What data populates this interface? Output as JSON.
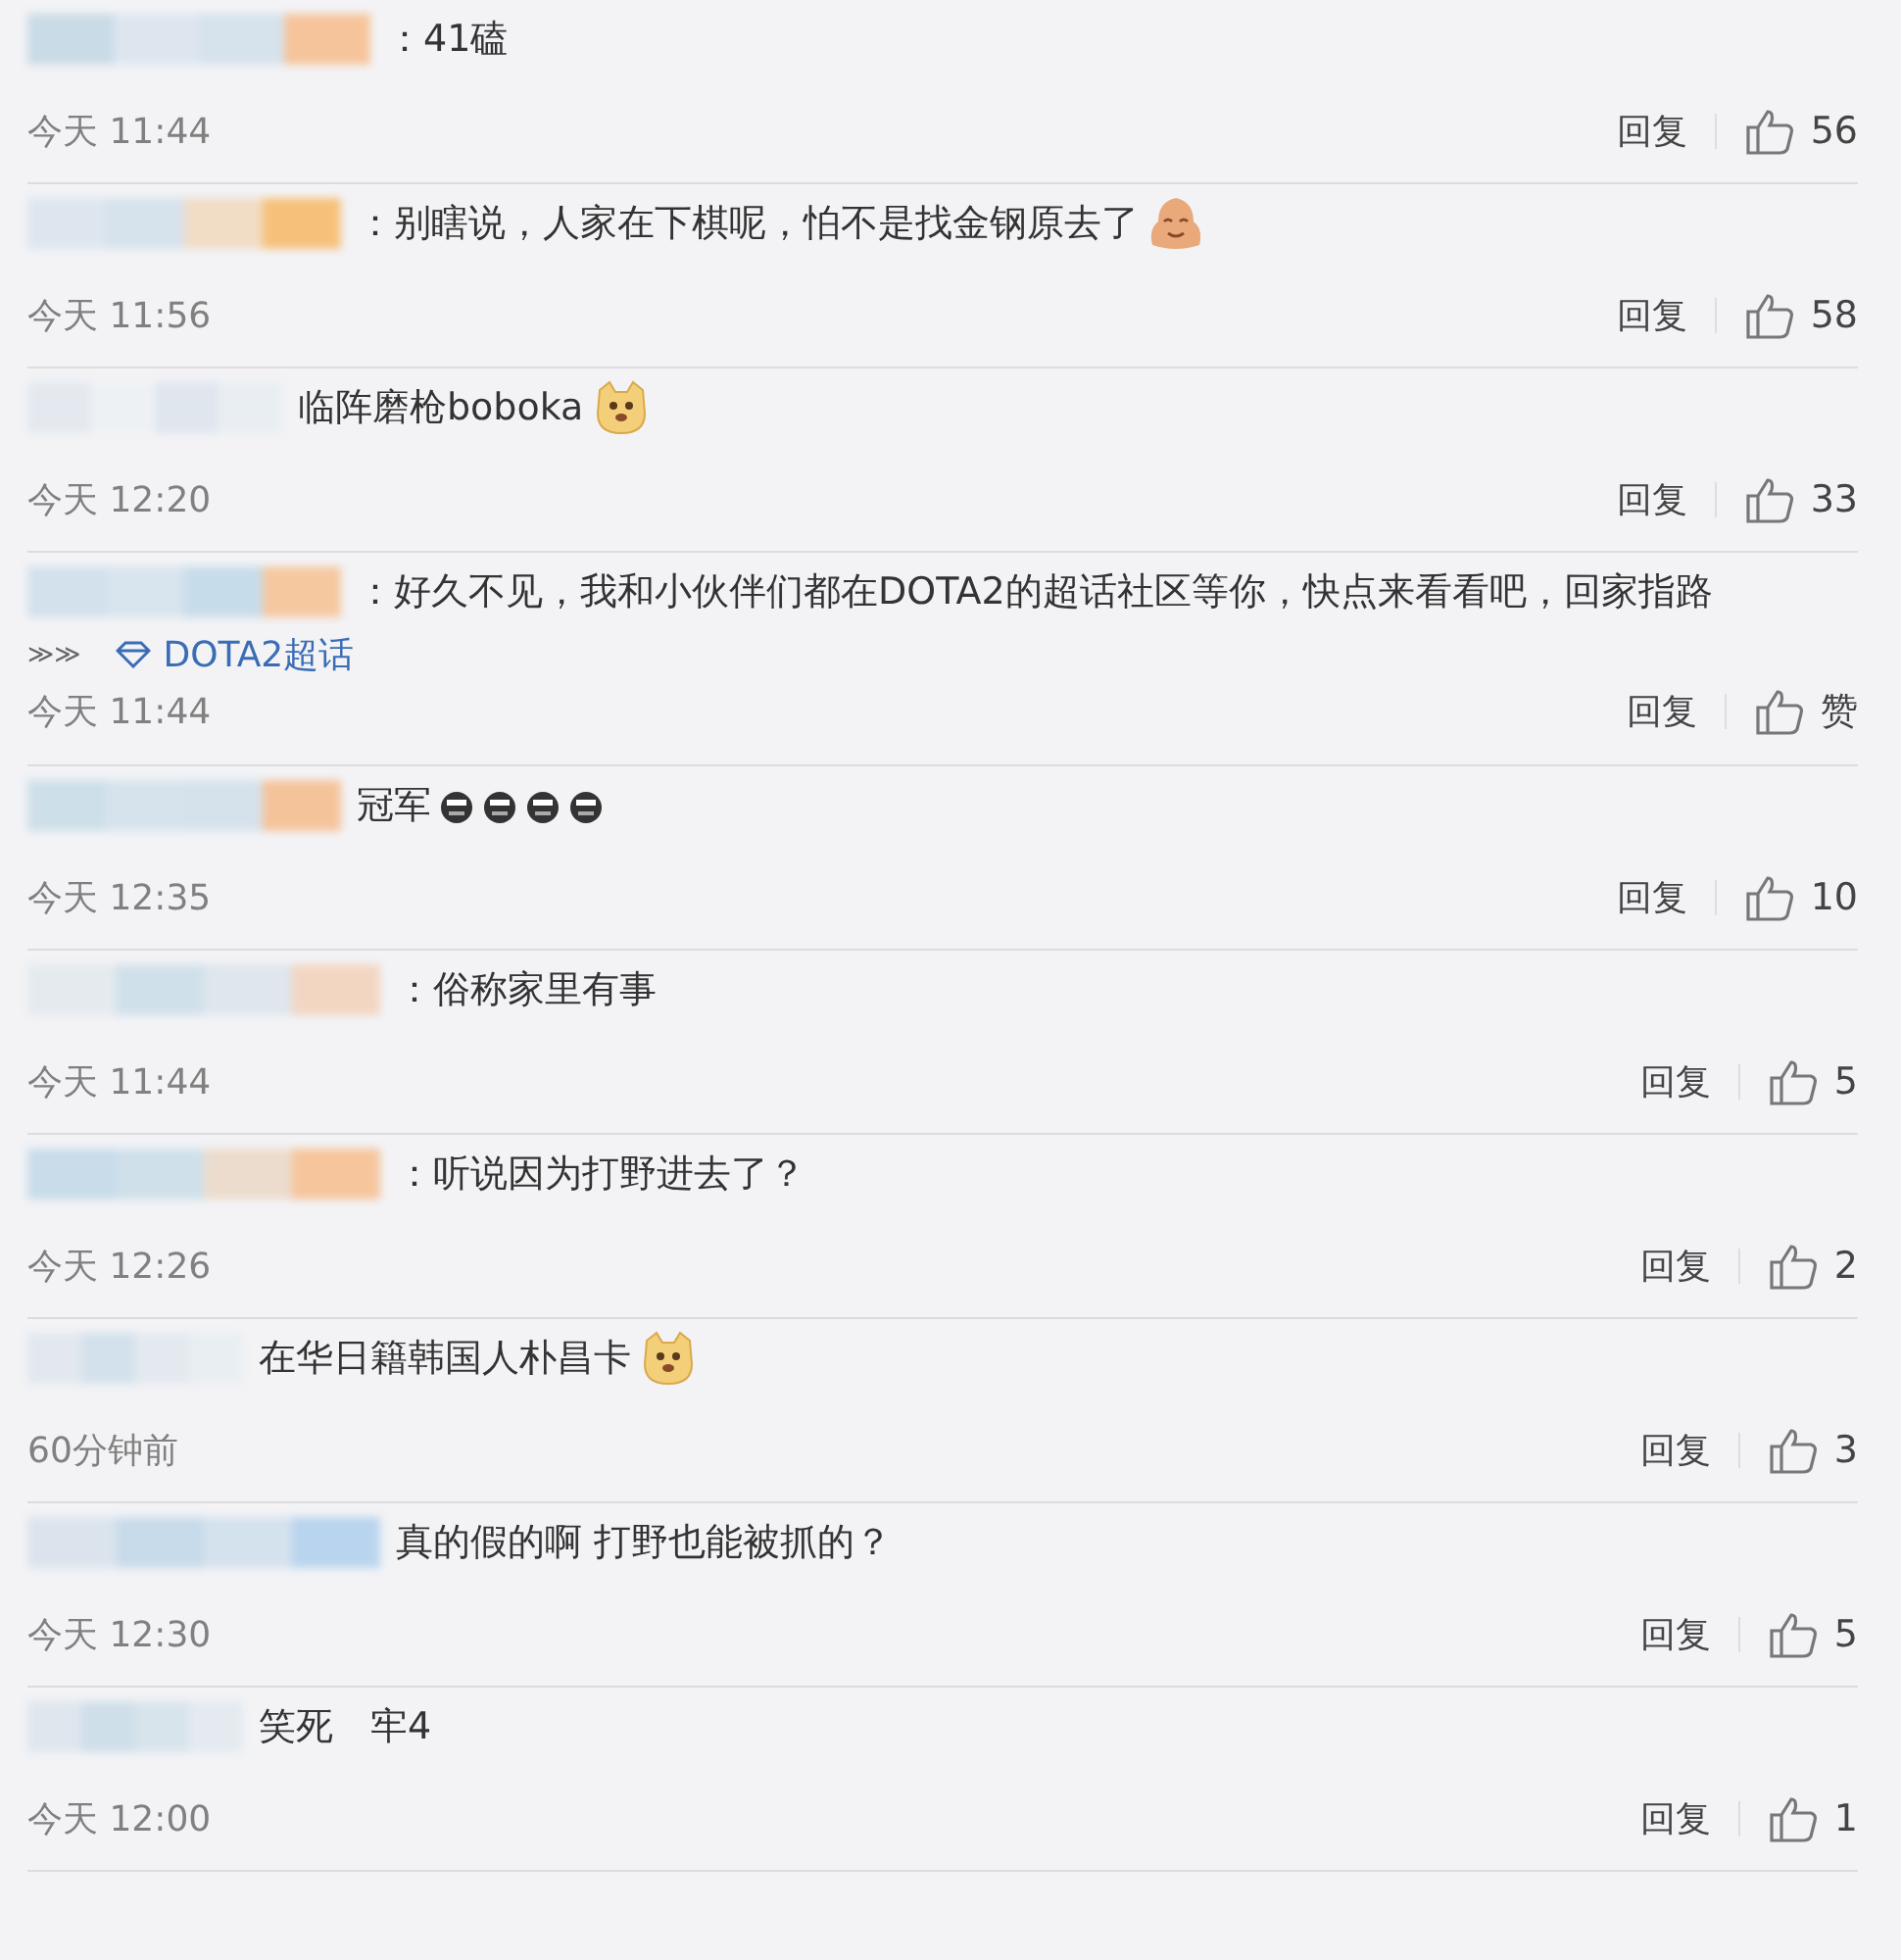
{
  "comments": [
    {
      "text": "：41磕",
      "time": "今天 11:44",
      "reply": "回复",
      "likes": "56"
    },
    {
      "text": "：别瞎说，人家在下棋呢，怕不是找金钢原去了",
      "emojis": [
        {
          "kind": "blob"
        }
      ],
      "time": "今天 11:56",
      "reply": "回复",
      "likes": "58"
    },
    {
      "text": "临阵磨枪boboka",
      "emojis": [
        {
          "kind": "dog"
        }
      ],
      "time": "今天 12:20",
      "reply": "回复",
      "likes": "33"
    },
    {
      "text": "：好久不见，我和小伙伴们都在DOTA2的超话社区等你，快点来看看吧，回家指路",
      "link_prefix": "≫≫",
      "link": "DOTA2超话",
      "time": "今天 11:44",
      "reply": "回复",
      "likes": "赞"
    },
    {
      "text": "冠军",
      "emojis": [
        {
          "kind": "dark"
        },
        {
          "kind": "dark"
        },
        {
          "kind": "dark"
        },
        {
          "kind": "dark"
        }
      ],
      "time": "今天 12:35",
      "reply": "回复",
      "likes": "10"
    },
    {
      "text": "：俗称家里有事",
      "time": "今天 11:44",
      "reply": "回复",
      "likes": "5"
    },
    {
      "text": "：听说因为打野进去了？",
      "time": "今天 12:26",
      "reply": "回复",
      "likes": "2"
    },
    {
      "text": "在华日籍韩国人朴昌卡",
      "emojis": [
        {
          "kind": "dog"
        }
      ],
      "time": "60分钟前",
      "reply": "回复",
      "likes": "3"
    },
    {
      "text": "真的假的啊 打野也能被抓的？",
      "time": "今天 12:30",
      "reply": "回复",
      "likes": "5"
    },
    {
      "text": "笑死　牢4",
      "time": "今天 12:00",
      "reply": "回复",
      "likes": "1"
    }
  ]
}
